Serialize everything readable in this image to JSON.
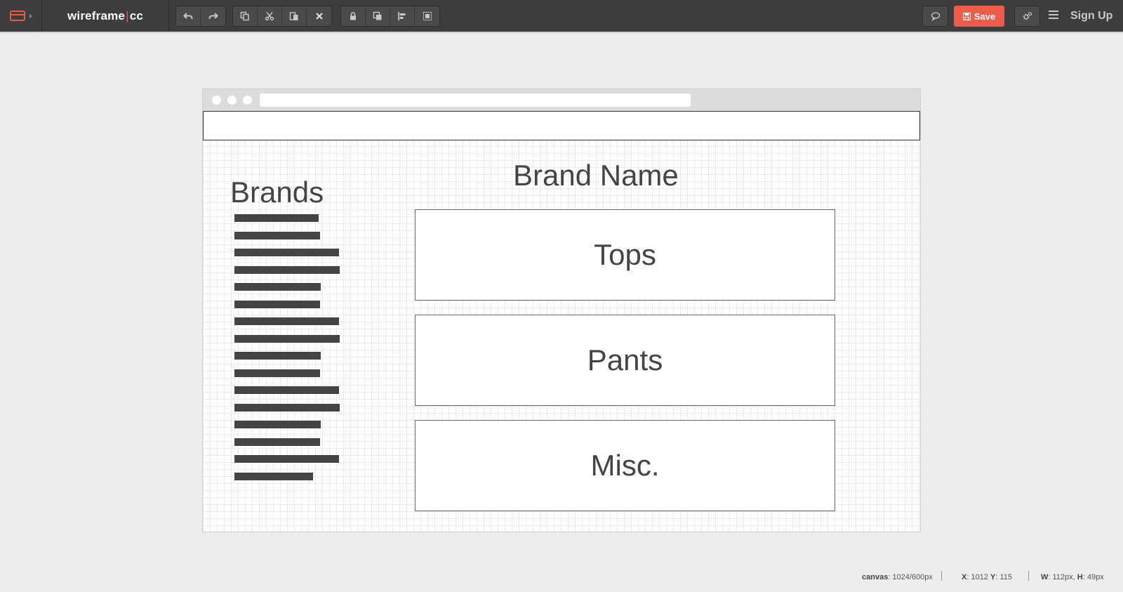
{
  "app": {
    "logo_left": "wireframe",
    "logo_sep": "|",
    "logo_right": "cc",
    "save_label": "Save",
    "signup_label": "Sign Up",
    "accent_color": "#ed5c4b"
  },
  "toolbar": {
    "history": [
      "undo-icon",
      "redo-icon"
    ],
    "clipboard": [
      "copy-icon",
      "cut-icon",
      "paste-icon",
      "delete-icon"
    ],
    "arrange": [
      "lock-icon",
      "bring-to-front-icon",
      "align-icon",
      "group-icon"
    ],
    "right": [
      "comment-icon",
      "settings-icon",
      "menu-icon"
    ]
  },
  "canvas": {
    "brands_heading": "Brands",
    "brand_name_heading": "Brand Name",
    "categories": [
      "Tops",
      "Pants",
      "Misc."
    ],
    "brand_list_lines": 16
  },
  "status": {
    "canvas_label": "canvas",
    "canvas_value": ": 1024/600px",
    "x_label": "X",
    "x_value": ": 1012",
    "y_label": "Y",
    "y_value": ": 115",
    "w_label": "W",
    "w_value": ": 112px,",
    "h_label": "H",
    "h_value": ": 49px"
  }
}
